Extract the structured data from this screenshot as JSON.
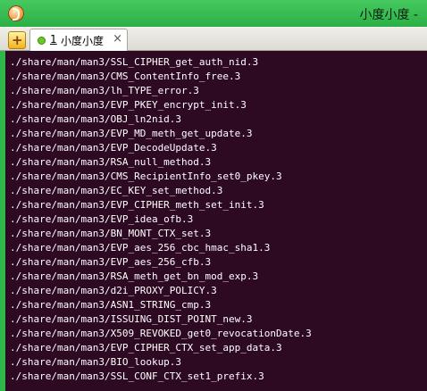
{
  "window": {
    "title": "小度小度 -",
    "app_icon": "app-icon"
  },
  "tabs": {
    "new_tab_icon": "+",
    "items": [
      {
        "number": "1",
        "label": "小度小度",
        "close_icon": "×",
        "status_color": "#66cc22"
      }
    ]
  },
  "colors": {
    "titlebar": "#2fb84a",
    "terminal_background": "#2d0922",
    "terminal_text": "#ffffff"
  },
  "terminal": {
    "lines": [
      "./share/man/man3/SSL_CIPHER_get_auth_nid.3",
      "./share/man/man3/CMS_ContentInfo_free.3",
      "./share/man/man3/lh_TYPE_error.3",
      "./share/man/man3/EVP_PKEY_encrypt_init.3",
      "./share/man/man3/OBJ_ln2nid.3",
      "./share/man/man3/EVP_MD_meth_get_update.3",
      "./share/man/man3/EVP_DecodeUpdate.3",
      "./share/man/man3/RSA_null_method.3",
      "./share/man/man3/CMS_RecipientInfo_set0_pkey.3",
      "./share/man/man3/EC_KEY_set_method.3",
      "./share/man/man3/EVP_CIPHER_meth_set_init.3",
      "./share/man/man3/EVP_idea_ofb.3",
      "./share/man/man3/BN_MONT_CTX_set.3",
      "./share/man/man3/EVP_aes_256_cbc_hmac_sha1.3",
      "./share/man/man3/EVP_aes_256_cfb.3",
      "./share/man/man3/RSA_meth_get_bn_mod_exp.3",
      "./share/man/man3/d2i_PROXY_POLICY.3",
      "./share/man/man3/ASN1_STRING_cmp.3",
      "./share/man/man3/ISSUING_DIST_POINT_new.3",
      "./share/man/man3/X509_REVOKED_get0_revocationDate.3",
      "./share/man/man3/EVP_CIPHER_CTX_set_app_data.3",
      "./share/man/man3/BIO_lookup.3",
      "./share/man/man3/SSL_CONF_CTX_set1_prefix.3"
    ]
  }
}
